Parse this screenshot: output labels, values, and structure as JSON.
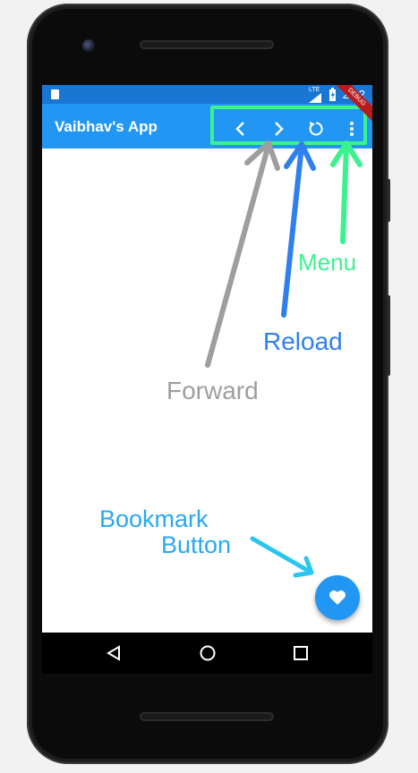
{
  "status_bar": {
    "time": "2:32",
    "network": "LTE"
  },
  "app_bar": {
    "title": "Vaibhav's App",
    "actions": [
      {
        "name": "back",
        "icon": "chevron-left-icon"
      },
      {
        "name": "forward",
        "icon": "chevron-right-icon"
      },
      {
        "name": "reload",
        "icon": "reload-icon"
      },
      {
        "name": "menu",
        "icon": "more-vert-icon"
      }
    ],
    "debug_banner": "DEBUG"
  },
  "fab": {
    "icon": "heart-icon"
  },
  "nav_bar": {
    "buttons": [
      "back-triangle-icon",
      "home-circle-icon",
      "recents-square-icon"
    ]
  },
  "annotations": {
    "menu": "Menu",
    "reload": "Reload",
    "forward": "Forward",
    "bookmark_line1": "Bookmark",
    "bookmark_line2": "Button"
  },
  "colors": {
    "appbar": "#2196f3",
    "statusbar": "#1976d2",
    "highlight": "#3cf28f",
    "menu_annotation": "#3cf28f",
    "reload_annotation": "#2f80ed",
    "forward_annotation": "#9e9e9e",
    "bookmark_annotation": "#29a8f0"
  }
}
